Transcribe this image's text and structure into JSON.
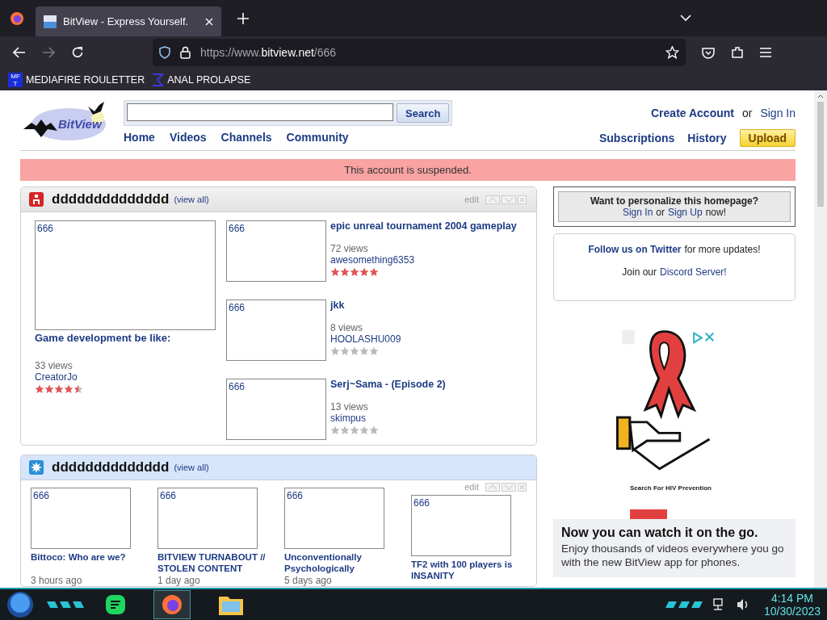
{
  "browser": {
    "tabs": [
      {
        "title": "BitView - Express Yourself.",
        "selected": true
      }
    ],
    "url": {
      "prefix": "https://www.",
      "domain": "bitview.net",
      "path": "/666"
    },
    "bookmarks": [
      {
        "badge": "MF T",
        "label": "MEDIAFIRE ROULETTER"
      },
      {
        "label": "ANAL PROLAPSE"
      }
    ]
  },
  "header": {
    "logo": "BitView",
    "search_button": "Search",
    "nav": [
      "Home",
      "Videos",
      "Channels",
      "Community"
    ],
    "create_account": "Create Account",
    "or": "or",
    "sign_in": "Sign In",
    "user_nav": [
      "Subscriptions",
      "History"
    ],
    "upload": "Upload"
  },
  "notice": "This account is suspended.",
  "modules": [
    {
      "kind": "list",
      "title": "dddddddddddddd",
      "view_all": "(view all)",
      "edit": "edit",
      "videos": [
        {
          "thumb": "666",
          "title": "Game development be like:",
          "views": "33 views",
          "author": "CreatorJo",
          "stars": 4.5
        },
        {
          "thumb": "666",
          "title": "epic unreal tournament 2004 gameplay",
          "views": "72 views",
          "author": "awesomething6353",
          "stars": 5
        },
        {
          "thumb": "666",
          "title": "jkk",
          "views": "8 views",
          "author": "HOOLASHU009",
          "stars": 0
        },
        {
          "thumb": "666",
          "title": "Serj~Sama - (Episode 2)",
          "views": "13 views",
          "author": "skimpus",
          "stars": 0
        }
      ]
    },
    {
      "kind": "grid",
      "title": "dddddddddddddd",
      "view_all": "(view all)",
      "edit": "edit",
      "videos": [
        {
          "thumb": "666",
          "title": "Bittoco: Who are we?",
          "time": "3 hours ago"
        },
        {
          "thumb": "666",
          "title": "BITVIEW TURNABOUT // STOLEN CONTENT",
          "time": "1 day ago"
        },
        {
          "thumb": "666",
          "title": "Unconventionally Psychologically",
          "time": "5 days ago"
        },
        {
          "thumb": "666",
          "title": "TF2 with 100 players is INSANITY"
        }
      ]
    }
  ],
  "sidebar": {
    "personalize": {
      "question": "Want to personalize this homepage?",
      "sign_in": "Sign In",
      "or": "or",
      "sign_up": "Sign Up",
      "now": "now!"
    },
    "social": {
      "twitter_link": "Follow us on Twitter",
      "twitter_rest": "for more updates!",
      "discord_prefix": "Join our",
      "discord_link": "Discord Server!"
    },
    "ad": {
      "kind": "picture",
      "headline": "Search For HIV Prevention"
    },
    "app_promo": {
      "title": "Now you can watch it on the go.",
      "text": "Enjoy thousands of videos everywhere you go with the new BitView app for phones."
    }
  },
  "taskbar": {
    "time": "4:14 PM",
    "date": "10/30/2023"
  }
}
